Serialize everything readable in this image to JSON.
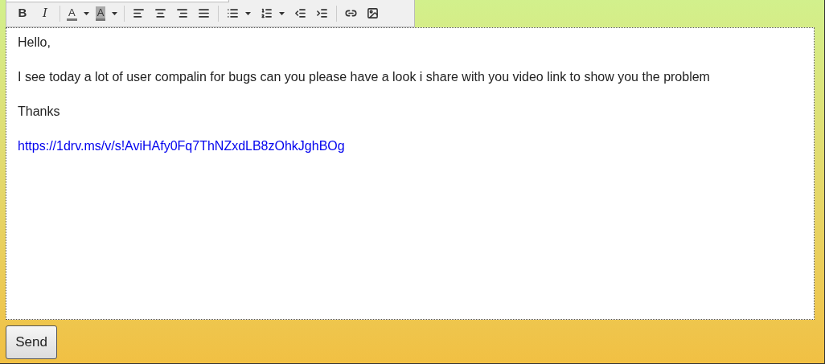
{
  "toolbar": [
    {
      "kind": "bold",
      "label": "B"
    },
    {
      "kind": "italic",
      "label": "I"
    },
    {
      "kind": "sep"
    },
    {
      "kind": "textcolor",
      "label": "A"
    },
    {
      "kind": "highlight",
      "label": "A"
    },
    {
      "kind": "sep"
    },
    {
      "kind": "alignleft"
    },
    {
      "kind": "aligncenter"
    },
    {
      "kind": "alignright"
    },
    {
      "kind": "justify"
    },
    {
      "kind": "sep"
    },
    {
      "kind": "bullets"
    },
    {
      "kind": "numbers"
    },
    {
      "kind": "outdent"
    },
    {
      "kind": "indent"
    },
    {
      "kind": "sep"
    },
    {
      "kind": "link"
    },
    {
      "kind": "image"
    }
  ],
  "editor": {
    "paragraphs": [
      {
        "kind": "text",
        "text": "Hello,"
      },
      {
        "kind": "text",
        "text": "I see today a lot of user compalin for bugs can you please have a look i share with you video link to show you the problem"
      },
      {
        "kind": "text",
        "text": "Thanks"
      },
      {
        "kind": "link",
        "text": "https://1drv.ms/v/s!AviHAfy0Fq7ThNZxdLB8zOhkJghBOg"
      }
    ]
  },
  "send_button": "Send"
}
